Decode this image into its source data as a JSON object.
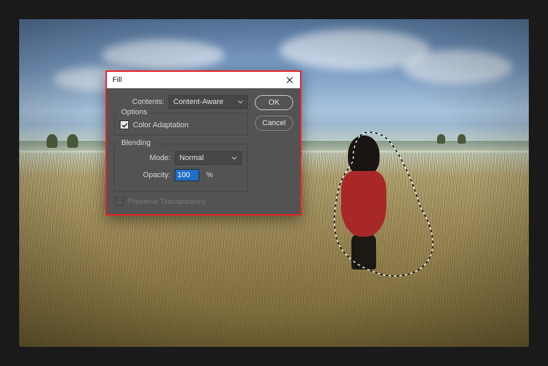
{
  "dialog": {
    "title": "Fill",
    "contents_label": "Contents:",
    "contents_value": "Content-Aware",
    "options_title": "Options",
    "color_adaptation_label": "Color Adaptation",
    "color_adaptation_checked": true,
    "blending_title": "Blending",
    "mode_label": "Mode:",
    "mode_value": "Normal",
    "opacity_label": "Opacity:",
    "opacity_value": "100",
    "opacity_unit": "%",
    "preserve_transparency_label": "Preserve Transparency",
    "preserve_transparency_enabled": false,
    "buttons": {
      "ok": "OK",
      "cancel": "Cancel"
    }
  },
  "icons": {
    "close": "close-icon",
    "chevron_down": "chevron-down-icon",
    "check": "check-icon"
  },
  "colors": {
    "highlight_border": "#e82020",
    "dialog_bg": "#535353",
    "selection_blue": "#1d6fc7"
  }
}
